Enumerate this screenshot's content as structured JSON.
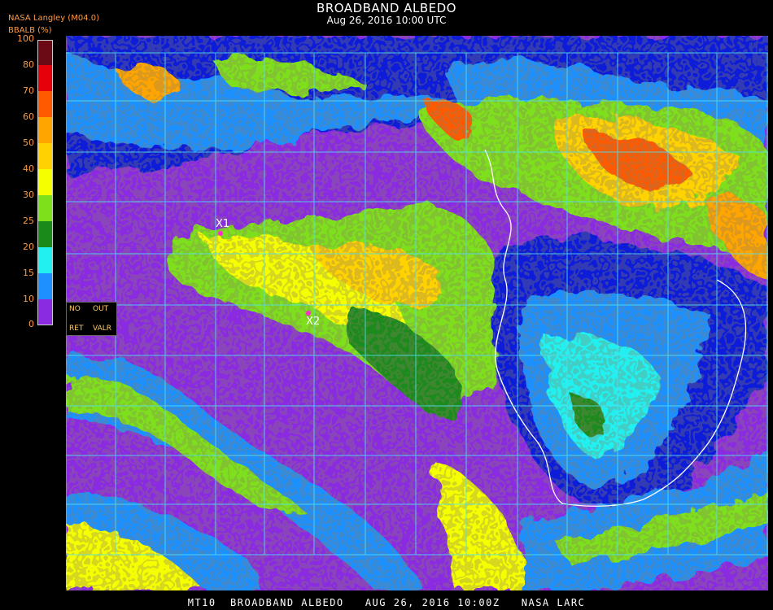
{
  "header": {
    "title": "BROADBAND ALBEDO",
    "datetime": "Aug 26, 2016 10:00 UTC",
    "product": "NASA Langley (M04.0)",
    "unit_label": "BBALB (%)"
  },
  "colorbar": {
    "ticks": [
      "100",
      "80",
      "70",
      "60",
      "50",
      "40",
      "30",
      "25",
      "20",
      "15",
      "10",
      "0"
    ],
    "colors": {
      "c100": "#6b0a14",
      "c80": "#e6000a",
      "c70": "#ff5a00",
      "c60": "#ffa500",
      "c50": "#ffd200",
      "c40": "#f5ff00",
      "c30": "#7ee01a",
      "c25": "#1a8a1a",
      "c20": "#20f0f0",
      "c15": "#1e90ff",
      "c10": "#0a1fd8",
      "c0": "#8a2be2"
    }
  },
  "legend_box": {
    "no": "NO",
    "out": "OUT",
    "ret": "RET",
    "valr": "VALR"
  },
  "markers": [
    {
      "label": "X1"
    },
    {
      "label": "X2"
    }
  ],
  "footer": "MT10  BROADBAND ALBEDO   AUG 26, 2016 10:00Z   NASA LARC",
  "map_colors": {
    "ocean": "#8a2be2",
    "grid": "#4fe0f0",
    "coast": "#ffffff"
  }
}
